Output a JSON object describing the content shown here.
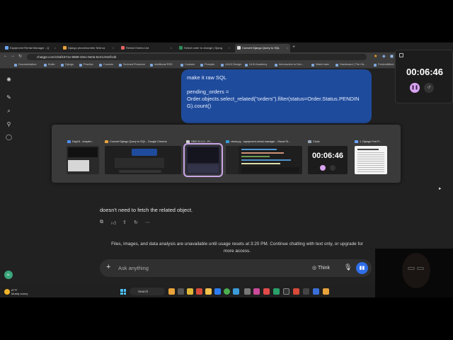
{
  "tabs": [
    {
      "label": "Equipment Rental Manager - Q",
      "active": false
    },
    {
      "label": "Django phonenumber field ca",
      "active": false
    },
    {
      "label": "Rental Orders List",
      "active": false
    },
    {
      "label": "Select order to change | Djang",
      "active": false
    },
    {
      "label": "Convert Django Query to SQL",
      "active": true
    }
  ],
  "browser": {
    "url": "chatgpt.com/c/6af1571e-9888-40ec-8e0a-5e21c916f14b",
    "profile_label": "Ask Gemini"
  },
  "bookmarks": [
    "Documentation",
    "Kotlin",
    "Django",
    "Practice",
    "Courses",
    "Scrimed Presence",
    "Additional RSS",
    "Courses",
    "Prompts",
    "UI/UX Design",
    "ULIH Academy",
    "Introduction to Dev...",
    "Watch later",
    "Dashboard | The Od...",
    "FontendMent"
  ],
  "message": {
    "line1": "make it raw SQL",
    "line2": "pending_orders =",
    "line3": "Order.objects.select_related(\"orders\").filter(status=Order.Status.PENDING).count()"
  },
  "assistant_tail": "doesn't need to fetch the related object.",
  "notice": "Files, images, and data analysis are unavailable until usage resets at 3:20 PM. Continue chatting with text only, or upgrade for more access.",
  "composer": {
    "placeholder": "Ask anything",
    "think_label": "Think"
  },
  "sidebar_avatar": "AL",
  "switcher": [
    {
      "title": "Day16 - chapter...",
      "icon_color": "#4f8ef7"
    },
    {
      "title": "Convert Django Query to SQL - Google Chrome",
      "icon_color": "#e8a33a"
    },
    {
      "title": "OBS 31.0.2 - Pr...",
      "icon_color": "#cccccc"
    },
    {
      "title": "views.py - equipment-rental-manager - Visual St...",
      "icon_color": "#3a9bd9"
    },
    {
      "title": "Clock",
      "icon_color": "#9aa7b8"
    },
    {
      "title": "1. Django Port P...",
      "icon_color": "#6aa5ff"
    }
  ],
  "clock_mini_time": "00:06:46",
  "clock": {
    "time": "00:06:46"
  },
  "weather": {
    "temp": "87°F",
    "desc": "Mostly sunny"
  },
  "taskbar_search": "Search",
  "colors": {
    "bubble": "#1f4b9c",
    "accent": "#2f6ee8",
    "timer_pause": "#d9a4f0"
  }
}
